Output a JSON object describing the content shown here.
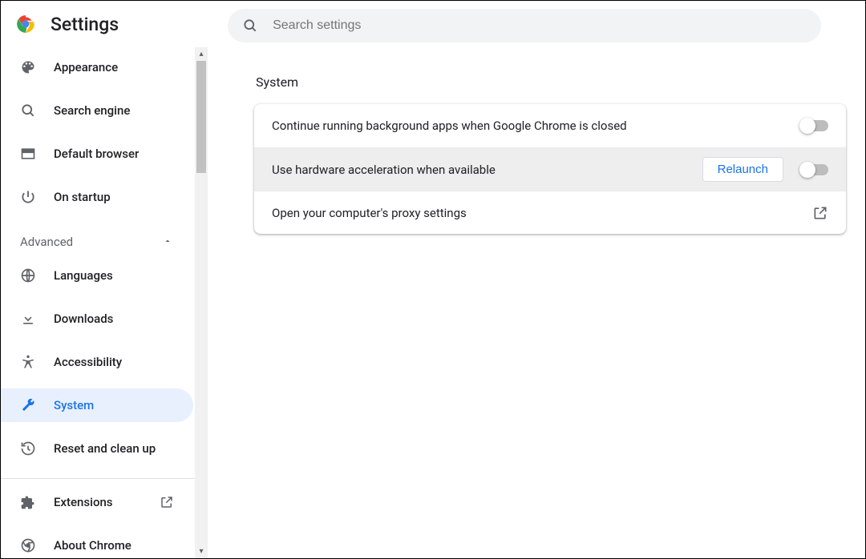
{
  "header": {
    "title": "Settings",
    "search_placeholder": "Search settings"
  },
  "sidebar": {
    "items": [
      {
        "icon": "palette",
        "label": "Appearance"
      },
      {
        "icon": "search",
        "label": "Search engine"
      },
      {
        "icon": "browser",
        "label": "Default browser"
      },
      {
        "icon": "power",
        "label": "On startup"
      }
    ],
    "advanced_label": "Advanced",
    "advanced_items": [
      {
        "icon": "globe",
        "label": "Languages"
      },
      {
        "icon": "download",
        "label": "Downloads"
      },
      {
        "icon": "accessibility",
        "label": "Accessibility"
      },
      {
        "icon": "wrench",
        "label": "System",
        "active": true
      },
      {
        "icon": "restore",
        "label": "Reset and clean up"
      }
    ],
    "footer_items": [
      {
        "icon": "extension",
        "label": "Extensions",
        "external": true
      },
      {
        "icon": "chrome-gray",
        "label": "About Chrome"
      }
    ]
  },
  "main": {
    "section_title": "System",
    "rows": [
      {
        "label": "Continue running background apps when Google Chrome is closed",
        "has_toggle": true,
        "toggle_on": false
      },
      {
        "label": "Use hardware acceleration when available",
        "has_toggle": true,
        "toggle_on": false,
        "relaunch": "Relaunch",
        "hover": true
      },
      {
        "label": "Open your computer's proxy settings",
        "external": true
      }
    ]
  }
}
